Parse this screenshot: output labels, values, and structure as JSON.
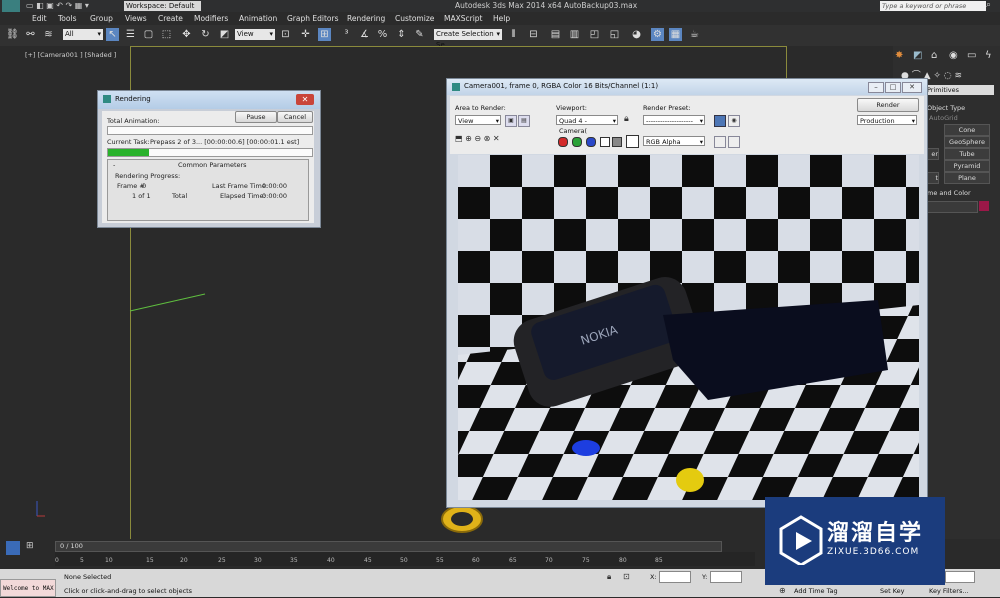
{
  "titlebar": {
    "workspace": "Workspace: Default",
    "app_title": "Autodesk 3ds Max  2014 x64     AutoBackup03.max",
    "search_placeholder": "Type a keyword or phrase"
  },
  "menu": [
    "Edit",
    "Tools",
    "Group",
    "Views",
    "Create",
    "Modifiers",
    "Animation",
    "Graph Editors",
    "Rendering",
    "Customize",
    "MAXScript",
    "Help"
  ],
  "toolbar": {
    "filter": "All",
    "ref_coord": "View",
    "selection_set": "Create Selection Se"
  },
  "viewport": {
    "label": "[+] [Camera001 ] [Shaded ]"
  },
  "command_panel": {
    "category": "Primitives",
    "object_type_title": "Object Type",
    "autogrid": "AutoGrid",
    "buttons": [
      "Cone",
      "GeoSphere",
      "er",
      "Tube",
      "Pyramid",
      "t",
      "Plane"
    ],
    "name_color_title": "ame and Color"
  },
  "render_dialog": {
    "title": "Rendering",
    "total_animation_label": "Total Animation:",
    "pause_label": "Pause",
    "cancel_label": "Cancel",
    "current_task_label": "Current Task:",
    "current_task_value": "Prepass 2 of 3... [00:00:00.6] [00:00:01.1 est]",
    "progress": 0.2,
    "common_params_title": "Common Parameters",
    "rendering_progress_label": "Rendering Progress:",
    "frame_label": "Frame #",
    "frame_value": "0",
    "of_label": "1 of 1",
    "total_label": "Total",
    "last_frame_time_label": "Last Frame Time:",
    "last_frame_time_value": "0:00:00",
    "elapsed_time_label": "Elapsed Time:",
    "elapsed_time_value": "0:00:00"
  },
  "frame_buffer": {
    "title": "Camera001, frame 0, RGBA Color 16 Bits/Channel (1:1)",
    "area_label": "Area to Render:",
    "area_value": "View",
    "viewport_label": "Viewport:",
    "viewport_value": "Quad 4 - Camera(",
    "preset_label": "Render Preset:",
    "preset_value": "--------------------",
    "render_button": "Render",
    "production_value": "Production",
    "channel_value": "RGB Alpha"
  },
  "timeline": {
    "frame_counter": "0 / 100",
    "ticks": [
      "0",
      "5",
      "10",
      "15",
      "20",
      "25",
      "30",
      "35",
      "40",
      "45",
      "50",
      "55",
      "60",
      "65",
      "70",
      "75",
      "80",
      "85"
    ]
  },
  "statusbar": {
    "script_listener": "Welcome to MAX",
    "selection_status": "None Selected",
    "prompt": "Click or click-and-drag to select objects",
    "x_label": "X:",
    "y_label": "Y:",
    "add_time_tag": "Add Time Tag",
    "set_key": "Set Key",
    "key_filters": "Key Filters..."
  },
  "watermark": {
    "brand": "溜溜自学",
    "url": "ZIXUE.3D66.COM"
  }
}
